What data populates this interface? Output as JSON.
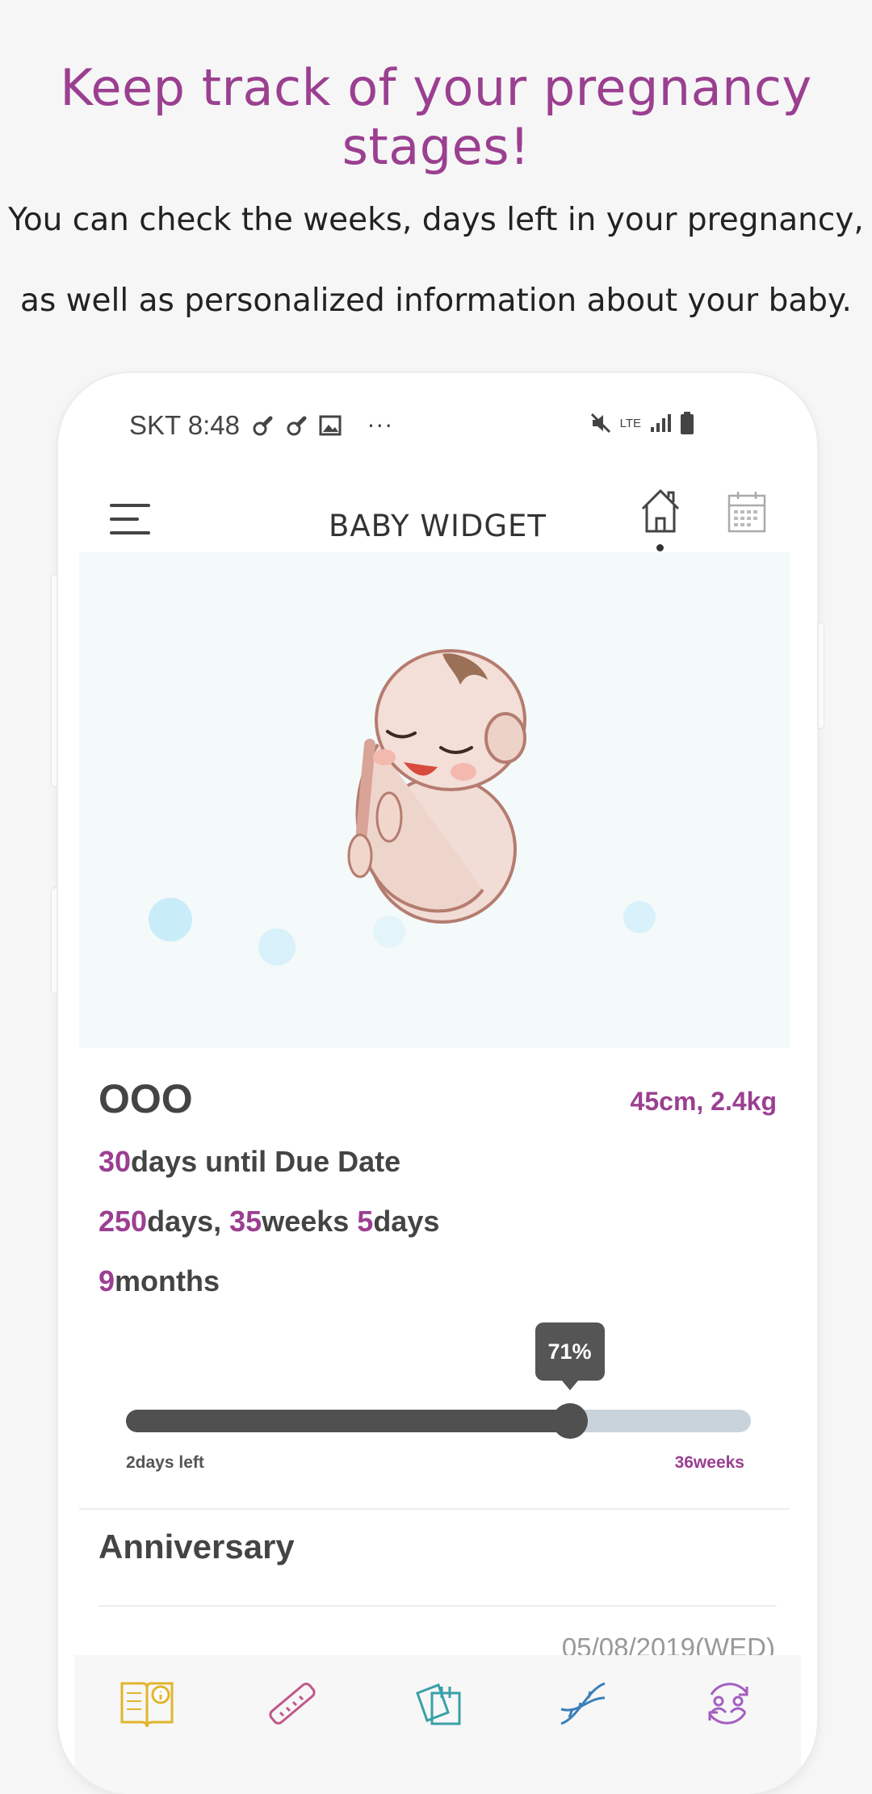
{
  "promo": {
    "headline": "Keep track of your pregnancy stages!",
    "line1": "You can check the weeks, days left in your pregnancy,",
    "line2": "as well as personalized information about your baby.",
    "headline_color": "#9b3f91"
  },
  "status_bar": {
    "carrier_time": "SKT 8:48",
    "network": "LTE"
  },
  "appbar": {
    "title": "BABY WIDGET"
  },
  "baby": {
    "name": "OOO",
    "size": "45cm, 2.4kg",
    "due": {
      "num": "30",
      "text": "days until Due Date"
    },
    "elapsed": {
      "days_num": "250",
      "days_text": "days, ",
      "weeks_num": "35",
      "weeks_text": "weeks ",
      "extra_num": "5",
      "extra_text": "days"
    },
    "months": {
      "num": "9",
      "text": "months"
    }
  },
  "progress": {
    "percent_label": "71%",
    "value": 0.71,
    "left_label": "2days left",
    "right_label": "36weeks"
  },
  "anniversary": {
    "title": "Anniversary",
    "date": "05/08/2019(WED)"
  },
  "bottom_nav": [
    "info-book-icon",
    "ruler-icon",
    "notes-icon",
    "dna-icon",
    "sync-users-icon"
  ],
  "colors": {
    "accent": "#9b3f91",
    "bar_fill": "#505050",
    "bar_track": "#c9d3dc",
    "nav_yellow": "#e1b52c",
    "nav_pink": "#c2588a",
    "nav_teal": "#3aa0a8",
    "nav_blue": "#3a7fb8",
    "nav_purple": "#a35fc0"
  }
}
